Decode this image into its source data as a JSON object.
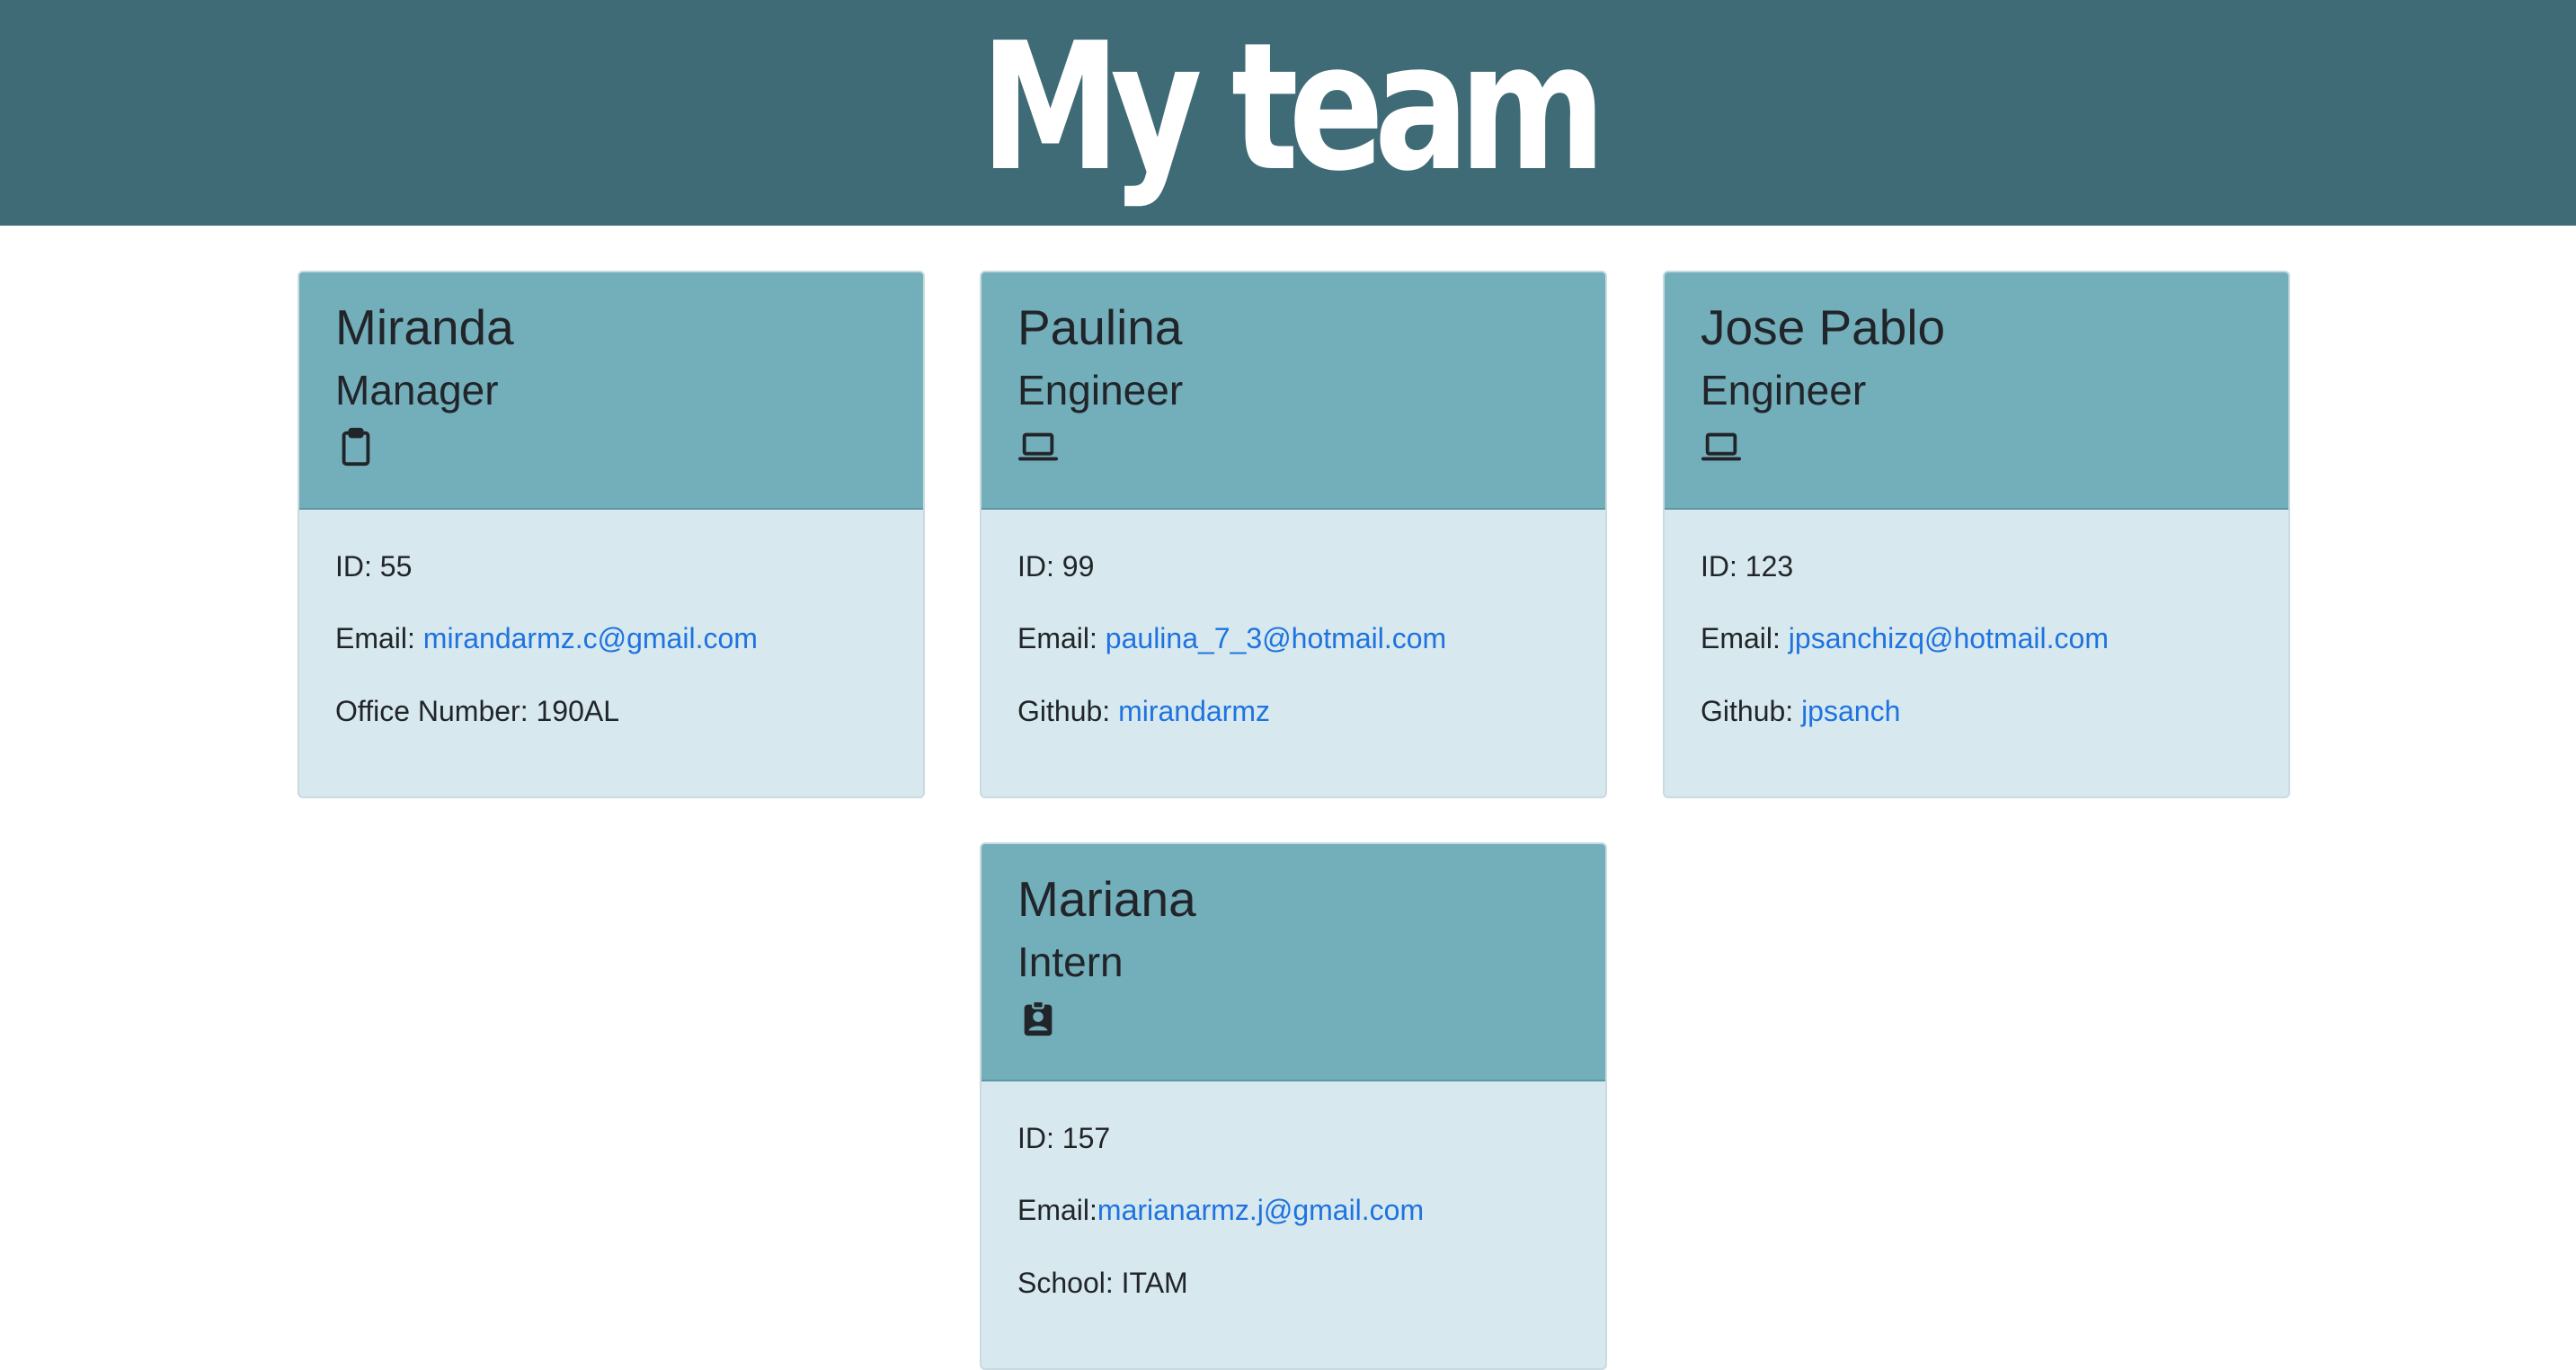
{
  "page": {
    "title": "My team"
  },
  "colors": {
    "header_bg": "#3f6b76",
    "card_head_bg": "#73aebb",
    "card_body_bg": "#d7e9ee",
    "link": "#1f73e0"
  },
  "cards": [
    {
      "name": "Miranda",
      "role": "Manager",
      "icon": "clipboard-icon",
      "id_label": "ID: 55",
      "email_label": "Email: ",
      "email": "mirandarmz.c@gmail.com",
      "extra_label": "Office Number: 190AL",
      "extra_link": ""
    },
    {
      "name": "Paulina",
      "role": "Engineer",
      "icon": "laptop-icon",
      "id_label": "ID: 99",
      "email_label": "Email: ",
      "email": "paulina_7_3@hotmail.com",
      "extra_label": "Github: ",
      "extra_link": "mirandarmz"
    },
    {
      "name": "Jose Pablo",
      "role": "Engineer",
      "icon": "laptop-icon",
      "id_label": "ID: 123",
      "email_label": "Email: ",
      "email": "jpsanchizq@hotmail.com",
      "extra_label": "Github: ",
      "extra_link": "jpsanch"
    },
    {
      "name": "Mariana",
      "role": "Intern",
      "icon": "badge-icon",
      "id_label": "ID: 157",
      "email_label": "Email:",
      "email": "marianarmz.j@gmail.com",
      "extra_label": "School: ITAM",
      "extra_link": ""
    }
  ]
}
